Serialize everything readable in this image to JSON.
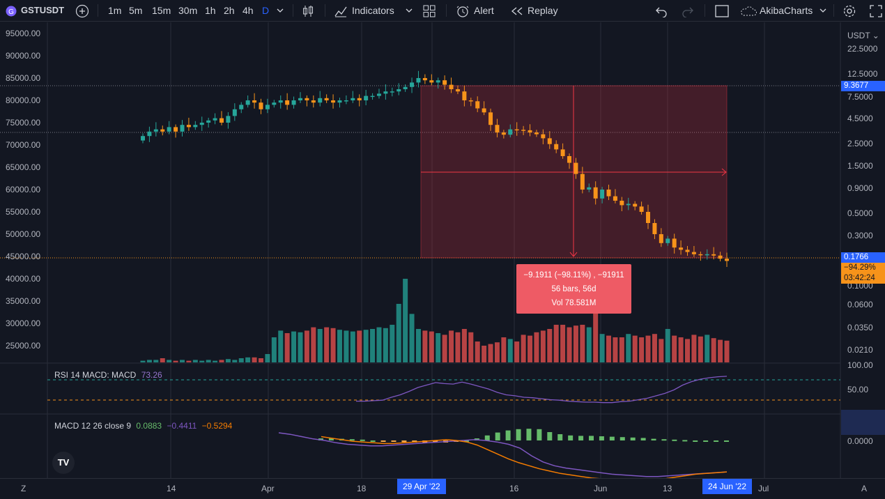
{
  "toolbar": {
    "symbol": "GSTUSDT",
    "intervals": [
      "1m",
      "5m",
      "15m",
      "30m",
      "1h",
      "2h",
      "4h",
      "D"
    ],
    "active_interval": "D",
    "indicators_label": "Indicators",
    "alert_label": "Alert",
    "replay_label": "Replay",
    "layout_name": "AkibaCharts"
  },
  "left_axis": [
    "95000.00",
    "90000.00",
    "85000.00",
    "80000.00",
    "75000.00",
    "70000.00",
    "65000.00",
    "60000.00",
    "55000.00",
    "50000.00",
    "45000.00",
    "40000.00",
    "35000.00",
    "30000.00",
    "25000.00"
  ],
  "right_axis": {
    "currency": "USDT",
    "labels": [
      "22.5000",
      "12.5000",
      "7.5000",
      "4.5000",
      "2.5000",
      "1.5000",
      "0.9000",
      "0.5000",
      "0.3000",
      "0.1000",
      "0.0600",
      "0.0350",
      "0.0210"
    ],
    "rsi_labels": [
      "100.00",
      "50.00"
    ],
    "macd_label": "0.0000",
    "high_tag": "9.3677",
    "last_price": "0.1766",
    "change_pct": "−94.29%",
    "countdown": "03:42:24"
  },
  "measure_tooltip": {
    "line1": "−9.1911 (−98.11%) , −91911",
    "line2": "56 bars, 56d",
    "line3": "Vol 78.581M"
  },
  "rsi_legend": {
    "label": "RSI 14 MACD: MACD",
    "value": "73.26"
  },
  "macd_legend": {
    "label": "MACD 12 26 close 9",
    "hist": "0.0883",
    "macd": "−0.4411",
    "signal": "−0.5294"
  },
  "x_axis": {
    "labels": [
      "14",
      "Apr",
      "18",
      "16",
      "Jun",
      "13",
      "Jul"
    ],
    "badge_left": "29 Apr '22",
    "badge_right": "24 Jun '22"
  },
  "bottom_left_icon": "Z",
  "bottom_right_icon": "A",
  "logo_text": "TV",
  "colors": {
    "up": "#26a69a",
    "down": "#f7931a",
    "macd": "#7e57c2",
    "signal": "#f57c00",
    "measure": "#f23645"
  },
  "chart_data": {
    "type": "candlestick",
    "title": "GSTUSDT",
    "y_scale": "log",
    "closes": [
      72,
      73,
      73.5,
      73,
      74,
      73,
      74.5,
      74,
      74.5,
      75,
      75.5,
      76,
      75,
      76.5,
      78,
      79,
      80,
      79.5,
      78,
      79,
      79.5,
      80,
      79,
      80,
      80.5,
      80,
      79.5,
      80.5,
      80,
      79.5,
      80,
      80,
      80.5,
      80,
      81,
      81,
      81.5,
      82,
      82,
      82.5,
      83,
      84,
      85,
      84.5,
      84,
      84.5,
      83.5,
      82.5,
      82,
      80,
      79.8,
      78.2,
      77.3,
      74.5,
      72.8,
      72.3,
      73.5,
      73.4,
      73.3,
      72.8,
      72.4,
      71.5,
      70.2,
      69,
      67.5,
      66,
      63.5,
      60,
      60.5,
      58,
      60,
      58.5,
      57.5,
      56.5,
      56.8,
      56.2,
      55,
      52.5,
      50,
      48,
      49,
      47,
      46.5,
      46,
      45.5,
      45.4,
      45.5,
      45.2,
      44.5,
      44
    ],
    "volume_relative": [
      0.02,
      0.03,
      0.03,
      0.05,
      0.03,
      0.02,
      0.03,
      0.02,
      0.03,
      0.02,
      0.03,
      0.02,
      0.03,
      0.04,
      0.03,
      0.05,
      0.06,
      0.06,
      0.05,
      0.1,
      0.3,
      0.38,
      0.35,
      0.37,
      0.36,
      0.38,
      0.42,
      0.4,
      0.42,
      0.41,
      0.39,
      0.38,
      0.37,
      0.38,
      0.39,
      0.4,
      0.42,
      0.41,
      0.45,
      0.7,
      1.0,
      0.58,
      0.4,
      0.38,
      0.37,
      0.35,
      0.33,
      0.38,
      0.36,
      0.4,
      0.36,
      0.25,
      0.2,
      0.22,
      0.24,
      0.3,
      0.28,
      0.25,
      0.33,
      0.32,
      0.36,
      0.38,
      0.4,
      0.45,
      0.45,
      0.42,
      0.44,
      0.45,
      0.42,
      0.75,
      0.34,
      0.32,
      0.3,
      0.3,
      0.34,
      0.32,
      0.3,
      0.32,
      0.34,
      0.28,
      0.4,
      0.32,
      0.3,
      0.28,
      0.33,
      0.31,
      0.33,
      0.29,
      0.27,
      0.26
    ],
    "rsi": [
      22,
      22,
      23,
      24,
      30,
      35,
      42,
      50,
      55,
      60,
      58,
      57,
      61,
      57,
      52,
      47,
      40,
      35,
      33,
      30,
      29,
      27,
      25,
      24,
      22,
      21,
      20,
      20,
      19,
      19,
      21,
      22,
      25,
      28,
      33,
      38,
      45,
      55,
      62,
      67,
      70,
      72,
      73
    ],
    "macd": [
      0.1,
      0.08,
      0.05,
      0.02,
      0.0,
      -0.03,
      -0.05,
      -0.06,
      -0.07,
      -0.07,
      -0.06,
      -0.05,
      -0.04,
      -0.03,
      -0.02,
      -0.01,
      0.0,
      0.01,
      0.0,
      -0.02,
      -0.05,
      -0.1,
      -0.2,
      -0.28,
      -0.33,
      -0.36,
      -0.38,
      -0.4,
      -0.42,
      -0.44,
      -0.45,
      -0.46,
      -0.47,
      -0.47,
      -0.46,
      -0.45,
      -0.44,
      -0.43,
      -0.42,
      -0.41
    ],
    "signal": [
      0.05,
      0.03,
      0.01,
      -0.01,
      -0.02,
      -0.03,
      -0.04,
      -0.04,
      -0.03,
      -0.02,
      -0.01,
      0.0,
      0.01,
      0.0,
      -0.02,
      -0.06,
      -0.12,
      -0.18,
      -0.24,
      -0.29,
      -0.33,
      -0.37,
      -0.4,
      -0.43,
      -0.45,
      -0.47,
      -0.49,
      -0.5,
      -0.51,
      -0.52,
      -0.52,
      -0.52,
      -0.51,
      -0.5,
      -0.48,
      -0.46,
      -0.44,
      -0.43,
      -0.42,
      -0.41
    ]
  }
}
